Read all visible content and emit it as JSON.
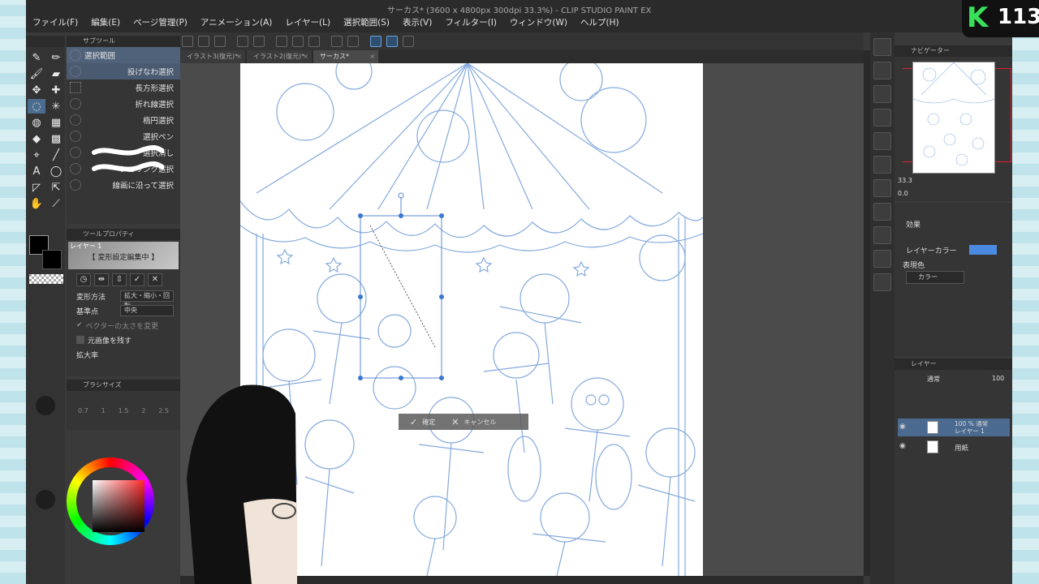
{
  "window": {
    "title": "サーカス* (3600 x 4800px 300dpi 33.3%) - CLIP STUDIO PAINT EX"
  },
  "menu": [
    "ファイル(F)",
    "編集(E)",
    "ページ管理(P)",
    "アニメーション(A)",
    "レイヤー(L)",
    "選択範囲(S)",
    "表示(V)",
    "フィルター(I)",
    "ウィンドウ(W)",
    "ヘルプ(H)"
  ],
  "tabs": [
    {
      "label": "イラスト3(復元)*"
    },
    {
      "label": "イラスト2(復元)*"
    },
    {
      "label": "サーカス*"
    }
  ],
  "subtool": {
    "header": "サブツール",
    "items": [
      {
        "label": "選択範囲"
      },
      {
        "label": "投げなわ選択"
      },
      {
        "label": "長方形選択"
      },
      {
        "label": "折れ線選択"
      },
      {
        "label": "楕円選択"
      },
      {
        "label": "選択ペン"
      },
      {
        "label": "選択消し"
      },
      {
        "label": "シュリンク選択"
      },
      {
        "label": "線画に沿って選択"
      }
    ]
  },
  "toolprop": {
    "header": "ツールプロパティ",
    "layer_name": "レイヤー 1",
    "editing_label": "【 変形設定編集中 】",
    "transform_method_label": "変形方法",
    "transform_method_value": "拡大・縮小・回転",
    "reference_label": "基準点",
    "reference_value": "中央",
    "vector_width_label": "ベクターの太さを変更",
    "keep_original_label": "元画像を残す",
    "scale_label": "拡大率"
  },
  "brushsize": {
    "header": "ブラシサイズ",
    "values": [
      "0.7",
      "1",
      "1.5",
      "2",
      "2.5"
    ]
  },
  "canvas": {
    "confirm_label": "確定",
    "cancel_label": "キャンセル"
  },
  "navigator": {
    "header": "ナビゲーター",
    "zoom": "33.3",
    "rotation": "0.0"
  },
  "layer_props": {
    "effect_label": "効果",
    "layer_color_label": "レイヤーカラー",
    "display_color_label": "表現色",
    "display_color_value": "カラー",
    "layer_color_hex": "#4a8ae0"
  },
  "layers": {
    "header": "レイヤー",
    "blend_mode": "通常",
    "opacity": "100",
    "rows": [
      {
        "info": "100 % 通常",
        "name": "レイヤー 1"
      },
      {
        "info": "",
        "name": "用紙"
      }
    ]
  },
  "overlay": {
    "logo_letter": "K",
    "logo_number": "113"
  }
}
